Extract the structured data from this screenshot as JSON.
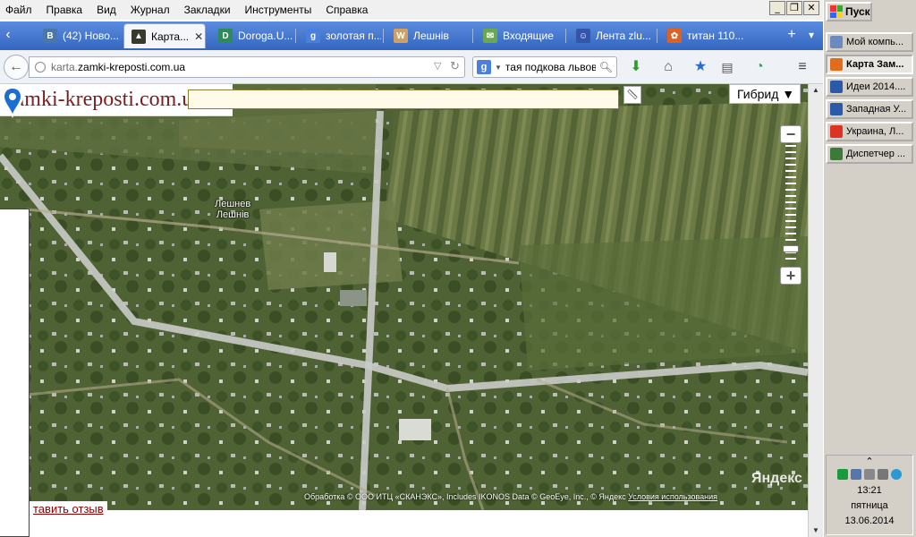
{
  "menubar": {
    "items": [
      "Файл",
      "Правка",
      "Вид",
      "Журнал",
      "Закладки",
      "Инструменты",
      "Справка"
    ]
  },
  "window_buttons": {
    "minimize": "_",
    "restore": "❐",
    "close": "✕"
  },
  "tabs": [
    {
      "label": "(42) Ново...",
      "icon": "vk-icon",
      "color": "#4a76a8",
      "glyph": "B"
    },
    {
      "label": "Карта...",
      "icon": "castle-icon",
      "color": "#3a3a2a",
      "glyph": "▲",
      "active": true
    },
    {
      "label": "Doroga.U...",
      "icon": "doroga-icon",
      "color": "#2e8b57",
      "glyph": "D"
    },
    {
      "label": "золотая п...",
      "icon": "google-icon",
      "color": "#4a7fe0",
      "glyph": "g"
    },
    {
      "label": "Лешнів",
      "icon": "wiki-icon",
      "color": "#d0a060",
      "glyph": "W"
    },
    {
      "label": "Входящие",
      "icon": "mail-icon",
      "color": "#6aa84f",
      "glyph": "✉"
    },
    {
      "label": "Лента zlu...",
      "icon": "user-icon",
      "color": "#3355aa",
      "glyph": "☺"
    },
    {
      "label": "титан 110...",
      "icon": "windows-icon",
      "color": "#e06020",
      "glyph": "✿"
    }
  ],
  "tabbar": {
    "prev": "‹",
    "new_tab": "+",
    "list": "▾"
  },
  "navbar": {
    "url_plain": "karta.",
    "url_domain": "zamki-kreposti.com.ua",
    "search_text": "тая подкова львова",
    "search_engine": "g"
  },
  "map": {
    "site_logo": "zamki-kreposti.com.ua",
    "map_type": "Гибрид ▼",
    "place_label_line1": "Лешнев",
    "place_label_line2": "Лешнів",
    "yandex_logo": "Яндекс",
    "copyright": "Обработка © ООО ИТЦ «СКАНЭКС», Includes IKONOS Data © GeoEye, Inc., © Яндекс",
    "terms": "Условия использования",
    "zoom_in": "+",
    "zoom_out": "−",
    "feedback": "тавить отзыв",
    "colors": {
      "field": "#5d6e3e",
      "road": "#c9ccc8",
      "marker": "#1b6fd1"
    }
  },
  "taskbar": {
    "start": "Пуск",
    "items": [
      {
        "label": "Мой компь...",
        "icon": "computer-icon",
        "color": "#6a8ac0"
      },
      {
        "label": "Карта Зам...",
        "icon": "firefox-icon",
        "color": "#e06c1c",
        "active": true
      },
      {
        "label": "Идеи 2014....",
        "icon": "word-icon",
        "color": "#2b5aa8"
      },
      {
        "label": "Западная У...",
        "icon": "word-icon",
        "color": "#2b5aa8"
      },
      {
        "label": "Украина, Л...",
        "icon": "chrome-icon",
        "color": "#dd3322"
      },
      {
        "label": "Диспетчер ...",
        "icon": "task-manager-icon",
        "color": "#3c7a3c"
      }
    ],
    "tray": {
      "expand": "⌃",
      "time": "13:21",
      "day": "пятница",
      "date": "13.06.2014"
    }
  }
}
